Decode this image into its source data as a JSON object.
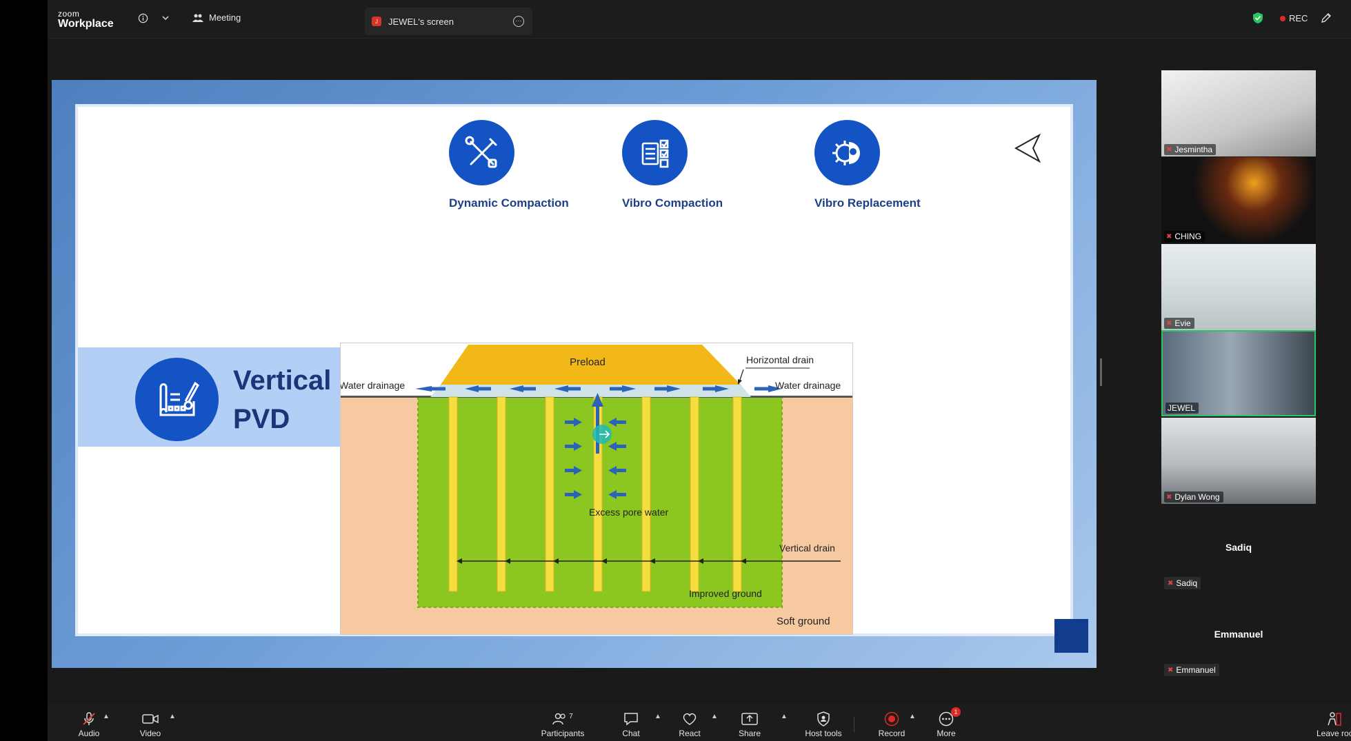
{
  "header": {
    "logo_top": "zoom",
    "logo_bottom": "Workplace",
    "meeting_label": "Meeting",
    "screen_tab_label": "JEWEL's screen",
    "screen_tab_avatar": "J",
    "rec_label": "REC"
  },
  "slide": {
    "features": [
      {
        "label": "Dynamic Compaction",
        "icon": "tools-icon"
      },
      {
        "label": "Vibro Compaction",
        "icon": "checklist-icon"
      },
      {
        "label": "Vibro Replacement",
        "icon": "gear-bulb-icon"
      }
    ],
    "banner_title": "Vertical Band Drains/ PVD",
    "diagram": {
      "preload": "Preload",
      "horizontal_drain": "Horizontal drain",
      "water_drainage_left": "Water drainage",
      "water_drainage_right": "Water drainage",
      "excess_pore_water": "Excess pore water",
      "vertical_drain": "Vertical drain",
      "improved_ground": "Improved ground",
      "soft_ground": "Soft ground"
    }
  },
  "participants": [
    {
      "name": "Jesmintha",
      "muted": true
    },
    {
      "name": "CHING",
      "muted": true
    },
    {
      "name": "Evie",
      "muted": true
    },
    {
      "name": "JEWEL",
      "muted": false,
      "active": true
    },
    {
      "name": "Dylan Wong",
      "muted": true
    }
  ],
  "no_video_participants": [
    {
      "title": "Sadiq",
      "name": "Sadiq"
    },
    {
      "title": "Emmanuel",
      "name": "Emmanuel"
    }
  ],
  "toolbar": {
    "audio": "Audio",
    "video": "Video",
    "participants": "Participants",
    "participants_count": "7",
    "chat": "Chat",
    "react": "React",
    "share": "Share",
    "host_tools": "Host tools",
    "record": "Record",
    "more": "More",
    "more_badge": "1",
    "leave": "Leave roo"
  },
  "colors": {
    "accent_blue": "#1453c4",
    "title_navy": "#1d3478",
    "banner_bg": "#b3cff5",
    "rec_red": "#e02828",
    "active_green": "#2fc462"
  }
}
